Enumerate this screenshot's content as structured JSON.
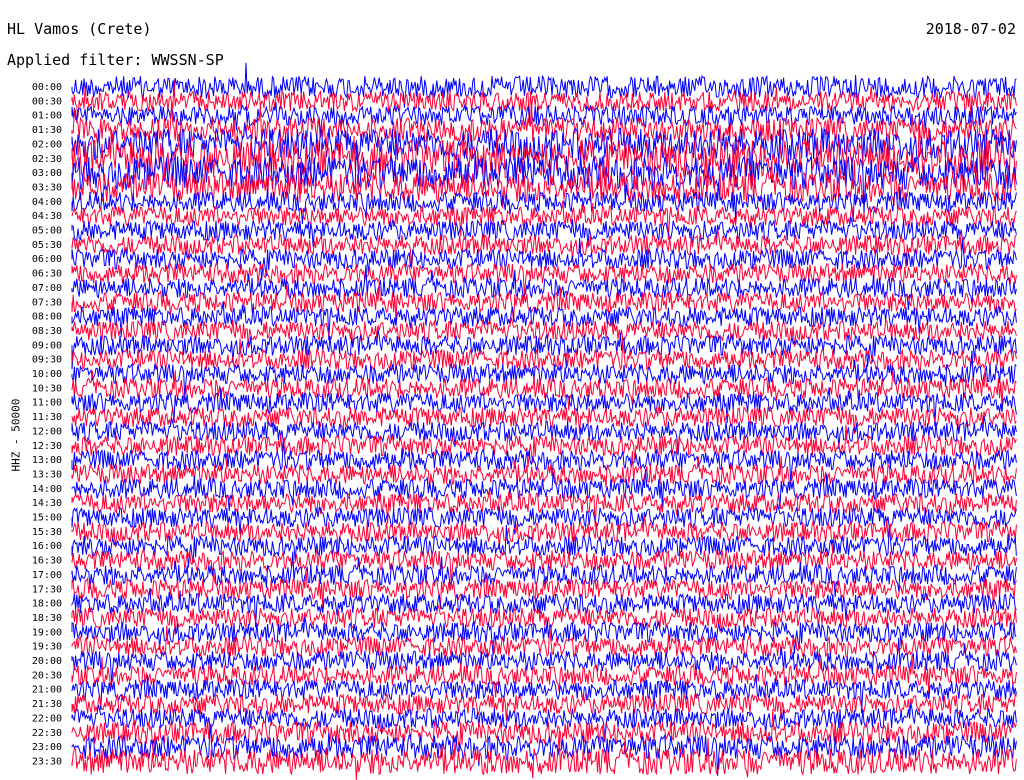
{
  "header": {
    "station": "HL Vamos (Crete)",
    "date": "2018-07-02",
    "filter": "Applied filter: WWSSN-SP"
  },
  "chart_data": {
    "type": "line",
    "title": "HL Vamos (Crete)",
    "subtitle": "Applied filter: WWSSN-SP",
    "ylabel": "HHZ - 50000",
    "xlabel": "",
    "series_colors": [
      "#0000ff",
      "#ff0033"
    ],
    "row_labels": [
      "00:00",
      "00:30",
      "01:00",
      "01:30",
      "02:00",
      "02:30",
      "03:00",
      "03:30",
      "04:00",
      "04:30",
      "05:00",
      "05:30",
      "06:00",
      "06:30",
      "07:00",
      "07:30",
      "08:00",
      "08:30",
      "09:00",
      "09:30",
      "10:00",
      "10:30",
      "11:00",
      "11:30",
      "12:00",
      "12:30",
      "13:00",
      "13:30",
      "14:00",
      "14:30",
      "15:00",
      "15:30",
      "16:00",
      "16:30",
      "17:00",
      "17:30",
      "18:00",
      "18:30",
      "19:00",
      "19:30",
      "20:00",
      "20:30",
      "21:00",
      "21:30",
      "22:00",
      "22:30",
      "23:00",
      "23:30"
    ],
    "row_amplitude": [
      1.1,
      1.0,
      1.0,
      1.2,
      1.6,
      1.9,
      1.7,
      1.5,
      1.0,
      1.0,
      1.0,
      1.0,
      1.0,
      1.0,
      1.0,
      1.0,
      1.0,
      1.0,
      1.0,
      1.0,
      1.0,
      1.0,
      1.0,
      1.0,
      1.0,
      1.0,
      1.0,
      1.0,
      1.0,
      1.0,
      1.0,
      1.0,
      1.0,
      1.0,
      1.0,
      1.0,
      1.0,
      1.0,
      1.0,
      1.0,
      1.0,
      1.0,
      1.0,
      1.0,
      1.0,
      1.1,
      1.2,
      1.3
    ],
    "grid": false
  }
}
